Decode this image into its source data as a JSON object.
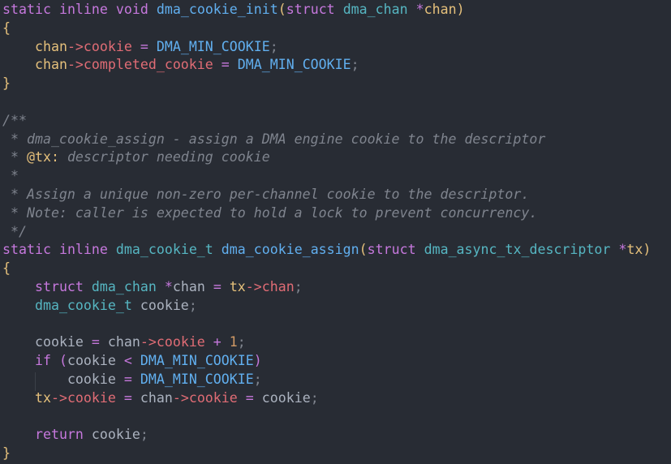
{
  "code_lines": [
    {
      "tokens": [
        {
          "t": "static",
          "c": "kw"
        },
        {
          "t": " ",
          "c": "pl"
        },
        {
          "t": "inline",
          "c": "kw"
        },
        {
          "t": " ",
          "c": "pl"
        },
        {
          "t": "void",
          "c": "kw"
        },
        {
          "t": " ",
          "c": "pl"
        },
        {
          "t": "dma_cookie_init",
          "c": "fn"
        },
        {
          "t": "(",
          "c": "br"
        },
        {
          "t": "struct",
          "c": "kw"
        },
        {
          "t": " ",
          "c": "pl"
        },
        {
          "t": "dma_chan",
          "c": "ty"
        },
        {
          "t": " ",
          "c": "pl"
        },
        {
          "t": "*",
          "c": "ptr"
        },
        {
          "t": "chan",
          "c": "id"
        },
        {
          "t": ")",
          "c": "br"
        }
      ]
    },
    {
      "tokens": [
        {
          "t": "{",
          "c": "br"
        }
      ]
    },
    {
      "tokens": [
        {
          "t": "    ",
          "c": "pl"
        },
        {
          "t": "chan",
          "c": "id"
        },
        {
          "t": "->",
          "c": "ar"
        },
        {
          "t": "cookie",
          "c": "fld"
        },
        {
          "t": " = ",
          "c": "op"
        },
        {
          "t": "DMA_MIN_COOKIE",
          "c": "mac"
        },
        {
          "t": ";",
          "c": "sc"
        }
      ]
    },
    {
      "tokens": [
        {
          "t": "    ",
          "c": "pl"
        },
        {
          "t": "chan",
          "c": "id"
        },
        {
          "t": "->",
          "c": "ar"
        },
        {
          "t": "completed_cookie",
          "c": "fld"
        },
        {
          "t": " = ",
          "c": "op"
        },
        {
          "t": "DMA_MIN_COOKIE",
          "c": "mac"
        },
        {
          "t": ";",
          "c": "sc"
        }
      ]
    },
    {
      "tokens": [
        {
          "t": "}",
          "c": "br"
        }
      ]
    },
    {
      "tokens": []
    },
    {
      "tokens": [
        {
          "t": "/**",
          "c": "cm"
        }
      ]
    },
    {
      "tokens": [
        {
          "t": " * dma_cookie_assign - assign a DMA engine cookie to the descriptor",
          "c": "cm"
        }
      ]
    },
    {
      "tokens": [
        {
          "t": " * ",
          "c": "cm"
        },
        {
          "t": "@tx:",
          "c": "tag"
        },
        {
          "t": " descriptor needing cookie",
          "c": "cm"
        }
      ]
    },
    {
      "tokens": [
        {
          "t": " *",
          "c": "cm"
        }
      ]
    },
    {
      "tokens": [
        {
          "t": " * Assign a unique non-zero per-channel cookie to the descriptor.",
          "c": "cm"
        }
      ]
    },
    {
      "tokens": [
        {
          "t": " * Note: caller is expected to hold a lock to prevent concurrency.",
          "c": "cm"
        }
      ]
    },
    {
      "tokens": [
        {
          "t": " */",
          "c": "cm"
        }
      ]
    },
    {
      "tokens": [
        {
          "t": "static",
          "c": "kw"
        },
        {
          "t": " ",
          "c": "pl"
        },
        {
          "t": "inline",
          "c": "kw"
        },
        {
          "t": " ",
          "c": "pl"
        },
        {
          "t": "dma_cookie_t",
          "c": "ty"
        },
        {
          "t": " ",
          "c": "pl"
        },
        {
          "t": "dma_cookie_assign",
          "c": "fn"
        },
        {
          "t": "(",
          "c": "br"
        },
        {
          "t": "struct",
          "c": "kw"
        },
        {
          "t": " ",
          "c": "pl"
        },
        {
          "t": "dma_async_tx_descriptor",
          "c": "ty"
        },
        {
          "t": " ",
          "c": "pl"
        },
        {
          "t": "*",
          "c": "ptr"
        },
        {
          "t": "tx",
          "c": "id"
        },
        {
          "t": ")",
          "c": "br"
        }
      ]
    },
    {
      "tokens": [
        {
          "t": "{",
          "c": "br"
        }
      ]
    },
    {
      "tokens": [
        {
          "t": "    ",
          "c": "pl"
        },
        {
          "t": "struct",
          "c": "kw"
        },
        {
          "t": " ",
          "c": "pl"
        },
        {
          "t": "dma_chan",
          "c": "ty"
        },
        {
          "t": " ",
          "c": "pl"
        },
        {
          "t": "*",
          "c": "ptr"
        },
        {
          "t": "chan",
          "c": "pl"
        },
        {
          "t": " = ",
          "c": "op"
        },
        {
          "t": "tx",
          "c": "id"
        },
        {
          "t": "->",
          "c": "ar"
        },
        {
          "t": "chan",
          "c": "fld"
        },
        {
          "t": ";",
          "c": "sc"
        }
      ]
    },
    {
      "tokens": [
        {
          "t": "    ",
          "c": "pl"
        },
        {
          "t": "dma_cookie_t",
          "c": "ty"
        },
        {
          "t": " ",
          "c": "pl"
        },
        {
          "t": "cookie",
          "c": "pl"
        },
        {
          "t": ";",
          "c": "sc"
        }
      ]
    },
    {
      "tokens": []
    },
    {
      "tokens": [
        {
          "t": "    ",
          "c": "pl"
        },
        {
          "t": "cookie",
          "c": "pl"
        },
        {
          "t": " = ",
          "c": "op"
        },
        {
          "t": "chan",
          "c": "pl"
        },
        {
          "t": "->",
          "c": "ar"
        },
        {
          "t": "cookie",
          "c": "fld"
        },
        {
          "t": " + ",
          "c": "op"
        },
        {
          "t": "1",
          "c": "num"
        },
        {
          "t": ";",
          "c": "sc"
        }
      ]
    },
    {
      "tokens": [
        {
          "t": "    ",
          "c": "pl"
        },
        {
          "t": "if",
          "c": "kw"
        },
        {
          "t": " ",
          "c": "pl"
        },
        {
          "t": "(",
          "c": "kw"
        },
        {
          "t": "cookie",
          "c": "pl"
        },
        {
          "t": " < ",
          "c": "op"
        },
        {
          "t": "DMA_MIN_COOKIE",
          "c": "mac"
        },
        {
          "t": ")",
          "c": "kw"
        }
      ]
    },
    {
      "tokens": [
        {
          "t": "        ",
          "c": "pl"
        },
        {
          "t": "cookie",
          "c": "pl"
        },
        {
          "t": " = ",
          "c": "op"
        },
        {
          "t": "DMA_MIN_COOKIE",
          "c": "mac"
        },
        {
          "t": ";",
          "c": "sc"
        }
      ]
    },
    {
      "tokens": [
        {
          "t": "    ",
          "c": "pl"
        },
        {
          "t": "tx",
          "c": "id"
        },
        {
          "t": "->",
          "c": "ar"
        },
        {
          "t": "cookie",
          "c": "fld"
        },
        {
          "t": " = ",
          "c": "op"
        },
        {
          "t": "chan",
          "c": "pl"
        },
        {
          "t": "->",
          "c": "ar"
        },
        {
          "t": "cookie",
          "c": "fld"
        },
        {
          "t": " = ",
          "c": "op"
        },
        {
          "t": "cookie",
          "c": "pl"
        },
        {
          "t": ";",
          "c": "sc"
        }
      ]
    },
    {
      "tokens": []
    },
    {
      "tokens": [
        {
          "t": "    ",
          "c": "pl"
        },
        {
          "t": "return",
          "c": "kw"
        },
        {
          "t": " ",
          "c": "pl"
        },
        {
          "t": "cookie",
          "c": "pl"
        },
        {
          "t": ";",
          "c": "sc"
        }
      ]
    },
    {
      "tokens": [
        {
          "t": "}",
          "c": "br"
        }
      ]
    }
  ]
}
